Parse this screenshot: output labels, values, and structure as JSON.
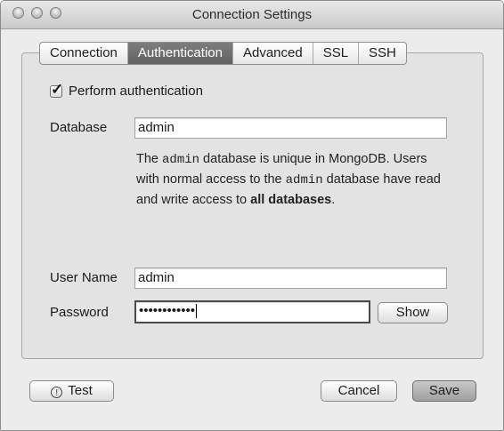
{
  "window": {
    "title": "Connection Settings"
  },
  "tabs": [
    {
      "label": "Connection"
    },
    {
      "label": "Authentication",
      "active": true
    },
    {
      "label": "Advanced"
    },
    {
      "label": "SSL"
    },
    {
      "label": "SSH"
    }
  ],
  "auth": {
    "perform_label": "Perform authentication",
    "perform_checked": true,
    "database_label": "Database",
    "database_value": "admin",
    "help": {
      "p1": "The ",
      "code1": "admin",
      "p2": " database is unique in MongoDB. Users with normal access to the ",
      "code2": "admin",
      "p3": " database have read and write access to ",
      "bold": "all databases",
      "p4": "."
    },
    "username_label": "User Name",
    "username_value": "admin",
    "password_label": "Password",
    "password_value": "••••••••••••",
    "show_label": "Show"
  },
  "footer": {
    "test_label": "Test",
    "test_icon": "exclamation-circle-icon",
    "cancel_label": "Cancel",
    "save_label": "Save"
  }
}
